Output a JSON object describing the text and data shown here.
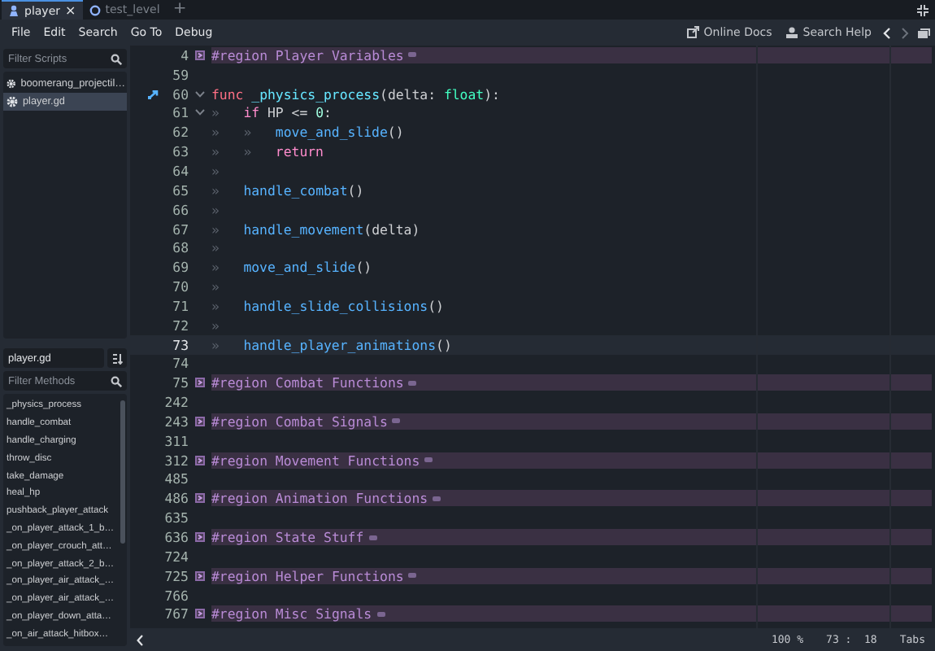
{
  "tabs": [
    {
      "label": "player",
      "kind": "scene",
      "selected": true,
      "close": "×"
    },
    {
      "label": "test_level",
      "kind": "node",
      "selected": false
    }
  ],
  "new_tab": "+",
  "menu": [
    "File",
    "Edit",
    "Search",
    "Go To",
    "Debug"
  ],
  "toolbar": [
    {
      "label": "Online Docs",
      "kind": "docs"
    },
    {
      "label": "Search Help",
      "kind": "help"
    }
  ],
  "scripts_panel": {
    "filter": {
      "placeholder": "Filter Scripts"
    },
    "scripts": [
      {
        "name": "boomerang_projectil…",
        "selected": false
      },
      {
        "name": "player.gd",
        "selected": true
      }
    ]
  },
  "methods_panel": {
    "file": "player.gd",
    "filter": {
      "placeholder": "Filter Methods"
    },
    "methods": [
      "_physics_process",
      "handle_combat",
      "handle_charging",
      "throw_disc",
      "take_damage",
      "heal_hp",
      "pushback_player_attack",
      "_on_player_attack_1_b…",
      "_on_player_crouch_att…",
      "_on_player_attack_2_b…",
      "_on_player_air_attack_…",
      "_on_player_air_attack_…",
      "_on_player_down_atta…",
      "_on_air_attack_hitbox…"
    ]
  },
  "editor": {
    "lines": [
      {
        "number": "4",
        "kind": "region",
        "folded": true,
        "current": false,
        "text": "#region Player Variables"
      },
      {
        "number": "59",
        "kind": "code",
        "current": false
      },
      {
        "number": "60",
        "kind": "code",
        "folded": false,
        "connected": true,
        "current": false,
        "tokens": [
          {
            "text": "func",
            "kind": "keyword"
          },
          {
            "text": "_physics_process",
            "kind": "name"
          },
          {
            "text": "(delta: ",
            "kind": "plain"
          },
          {
            "text": "float",
            "kind": "type"
          },
          {
            "text": "):",
            "kind": "plain"
          }
        ]
      },
      {
        "number": "61",
        "kind": "code",
        "folded": false,
        "current": false,
        "indent": [
          "»"
        ],
        "tokens": [
          {
            "text": "if",
            "kind": "control"
          },
          {
            "text": "HP <= ",
            "kind": "plain"
          },
          {
            "text": "0",
            "kind": "number"
          },
          {
            "text": ":",
            "kind": "plain"
          }
        ]
      },
      {
        "number": "62",
        "kind": "code",
        "current": false,
        "indent": [
          "»",
          "»"
        ],
        "tokens": [
          {
            "text": "move_and_slide",
            "kind": "call"
          },
          {
            "text": "()",
            "kind": "plain"
          }
        ]
      },
      {
        "number": "63",
        "kind": "code",
        "current": false,
        "indent": [
          "»",
          "»"
        ],
        "tokens": [
          {
            "text": "return",
            "kind": "control"
          }
        ]
      },
      {
        "number": "64",
        "kind": "code",
        "current": false,
        "indent": [
          "»"
        ]
      },
      {
        "number": "65",
        "kind": "code",
        "current": false,
        "indent": [
          "»"
        ],
        "tokens": [
          {
            "text": "handle_combat",
            "kind": "call"
          },
          {
            "text": "()",
            "kind": "plain"
          }
        ]
      },
      {
        "number": "66",
        "kind": "code",
        "current": false,
        "indent": [
          "»"
        ]
      },
      {
        "number": "67",
        "kind": "code",
        "current": false,
        "indent": [
          "»"
        ],
        "tokens": [
          {
            "text": "handle_movement",
            "kind": "call"
          },
          {
            "text": "(delta)",
            "kind": "plain"
          }
        ]
      },
      {
        "number": "68",
        "kind": "code",
        "current": false,
        "indent": [
          "»"
        ]
      },
      {
        "number": "69",
        "kind": "code",
        "current": false,
        "indent": [
          "»"
        ],
        "tokens": [
          {
            "text": "move_and_slide",
            "kind": "call"
          },
          {
            "text": "()",
            "kind": "plain"
          }
        ]
      },
      {
        "number": "70",
        "kind": "code",
        "current": false,
        "indent": [
          "»"
        ]
      },
      {
        "number": "71",
        "kind": "code",
        "current": false,
        "indent": [
          "»"
        ],
        "tokens": [
          {
            "text": "handle_slide_collisions",
            "kind": "call"
          },
          {
            "text": "()",
            "kind": "plain"
          }
        ]
      },
      {
        "number": "72",
        "kind": "code",
        "current": false,
        "indent": [
          "»"
        ]
      },
      {
        "number": "73",
        "kind": "code",
        "current": true,
        "indent": [
          "»"
        ],
        "tokens": [
          {
            "text": "handle_player_animations",
            "kind": "call"
          },
          {
            "text": "()",
            "kind": "plain"
          }
        ]
      },
      {
        "number": "74",
        "kind": "code",
        "current": false
      },
      {
        "number": "75",
        "kind": "region",
        "folded": true,
        "current": false,
        "text": "#region Combat Functions"
      },
      {
        "number": "242",
        "kind": "code",
        "current": false
      },
      {
        "number": "243",
        "kind": "region",
        "folded": true,
        "current": false,
        "text": "#region Combat Signals"
      },
      {
        "number": "311",
        "kind": "code",
        "current": false
      },
      {
        "number": "312",
        "kind": "region",
        "folded": true,
        "current": false,
        "text": "#region Movement Functions"
      },
      {
        "number": "485",
        "kind": "code",
        "current": false
      },
      {
        "number": "486",
        "kind": "region",
        "folded": true,
        "current": false,
        "text": "#region Animation Functions"
      },
      {
        "number": "635",
        "kind": "code",
        "current": false
      },
      {
        "number": "636",
        "kind": "region",
        "folded": true,
        "current": false,
        "text": "#region State Stuff"
      },
      {
        "number": "724",
        "kind": "code",
        "current": false
      },
      {
        "number": "725",
        "kind": "region",
        "folded": true,
        "current": false,
        "text": "#region Helper Functions"
      },
      {
        "number": "766",
        "kind": "code",
        "current": false
      },
      {
        "number": "767",
        "kind": "region",
        "folded": true,
        "current": false,
        "text": "#region Misc Signals"
      }
    ]
  },
  "status_bar": {
    "zoom": "100 %",
    "position": "73 :  18",
    "indentation": "Tabs"
  }
}
